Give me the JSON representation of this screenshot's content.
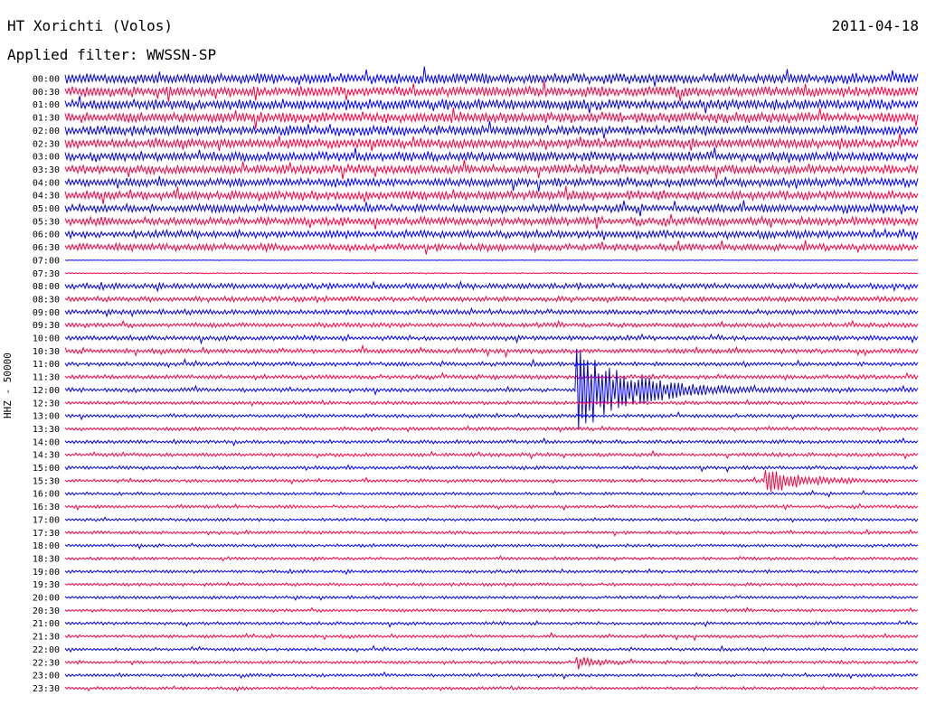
{
  "header": {
    "station": "HT Xorichti (Volos)",
    "date": "2011-04-18",
    "filter": "Applied filter: WWSSN-SP",
    "channel": "HHZ - 50000"
  },
  "chart_data": {
    "type": "line",
    "title": "HT Xorichti (Volos)",
    "subtitle": "Applied filter: WWSSN-SP",
    "ylabel": "HHZ - 50000",
    "xlabel": "",
    "row_labels": [
      "00:00",
      "00:30",
      "01:00",
      "01:30",
      "02:00",
      "02:30",
      "03:00",
      "03:30",
      "04:00",
      "04:30",
      "05:00",
      "05:30",
      "06:00",
      "06:30",
      "07:00",
      "07:30",
      "08:00",
      "08:30",
      "09:00",
      "09:30",
      "10:00",
      "10:30",
      "11:00",
      "11:30",
      "12:00",
      "12:30",
      "13:00",
      "13:30",
      "14:00",
      "14:30",
      "15:00",
      "15:30",
      "16:00",
      "16:30",
      "17:00",
      "17:30",
      "18:00",
      "18:30",
      "19:00",
      "19:30",
      "20:00",
      "20:30",
      "21:00",
      "21:30",
      "22:00",
      "22:30",
      "23:00",
      "23:30"
    ],
    "row_duration_minutes": 30,
    "row_amplitude": [
      1.0,
      1.0,
      1.0,
      1.0,
      0.95,
      0.95,
      0.9,
      0.9,
      0.85,
      0.85,
      0.8,
      0.8,
      0.75,
      0.7,
      0.05,
      0.1,
      0.55,
      0.5,
      0.5,
      0.45,
      0.45,
      0.45,
      0.4,
      0.4,
      0.4,
      0.35,
      0.35,
      0.35,
      0.35,
      0.35,
      0.35,
      0.3,
      0.3,
      0.3,
      0.3,
      0.3,
      0.3,
      0.3,
      0.3,
      0.3,
      0.3,
      0.3,
      0.3,
      0.3,
      0.3,
      0.3,
      0.3,
      0.3
    ],
    "colors": [
      "#0000ff",
      "#ff0040"
    ],
    "events": [
      {
        "row": 24,
        "start_fraction": 0.6,
        "amplitude": 6.0,
        "decay_fraction": 0.06
      },
      {
        "row": 31,
        "start_fraction": 0.82,
        "amplitude": 2.0,
        "decay_fraction": 0.04
      },
      {
        "row": 45,
        "start_fraction": 0.6,
        "amplitude": 0.9,
        "decay_fraction": 0.02
      }
    ],
    "grid": false,
    "legend": "none"
  }
}
